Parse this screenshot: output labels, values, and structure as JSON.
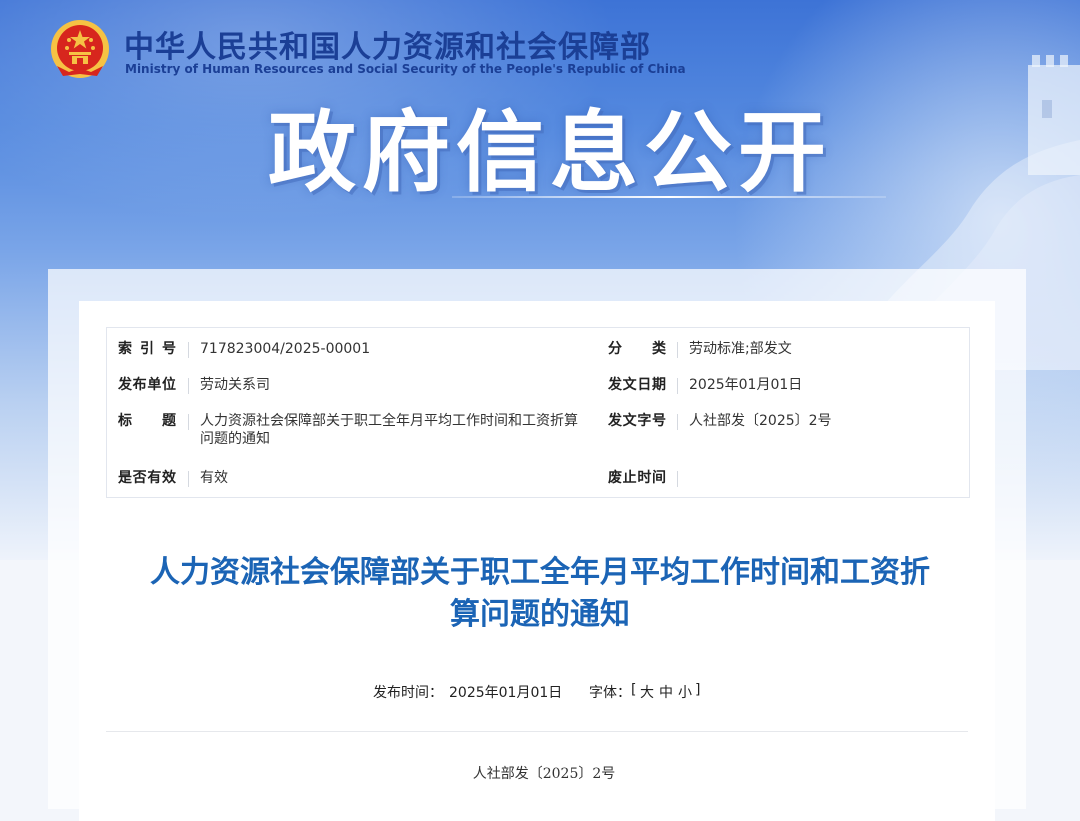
{
  "header": {
    "ministry_cn": "中华人民共和国人力资源和社会保障部",
    "ministry_en": "Ministry of Human Resources and Social Security of the People's Republic of China",
    "banner_title": "政府信息公开"
  },
  "meta": {
    "index_no": {
      "label": "索引号",
      "value": "717823004/2025-00001"
    },
    "category": {
      "label": "分类",
      "value": "劳动标准;部发文"
    },
    "publisher": {
      "label": "发布单位",
      "value": "劳动关系司"
    },
    "issue_date": {
      "label": "发文日期",
      "value": "2025年01月01日"
    },
    "title": {
      "label": "标题",
      "value_line1": "人力资源社会保障部关于职工全年月平均工作时间和工资折算",
      "value_line2": "问题的通知"
    },
    "doc_no": {
      "label": "发文字号",
      "value": "人社部发〔2025〕2号"
    },
    "validity": {
      "label": "是否有效",
      "value": "有效"
    },
    "repeal_time": {
      "label": "废止时间",
      "value": ""
    }
  },
  "article": {
    "title_line1": "人力资源社会保障部关于职工全年月平均工作时间和工资折",
    "title_line2": "算问题的通知",
    "publish_label": "发布时间：",
    "publish_date": "2025年01月01日",
    "font_label": "字体：",
    "font_open": "[",
    "font_large": "大",
    "font_medium": "中",
    "font_small": "小",
    "font_close": "]",
    "doc_number": "人社部发〔2025〕2号"
  },
  "colors": {
    "ministry_blue": "#1b3f96",
    "title_blue": "#1b64b5",
    "emblem_red": "#d7261d",
    "emblem_gold": "#f6c244"
  },
  "icons": {
    "emblem": "national-emblem-icon"
  }
}
